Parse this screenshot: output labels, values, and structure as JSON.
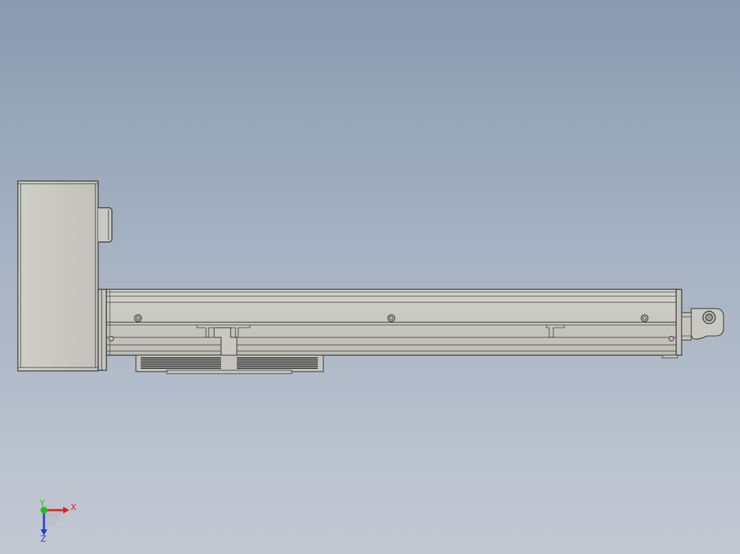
{
  "view": {
    "background_top": "#8a9bb0",
    "background_bottom": "#c3c9d3",
    "part_fill": "#c7c7c1",
    "part_edge": "#2a2a2a"
  },
  "triad": {
    "x_label": "X",
    "y_label": "Y",
    "z_label": "Z",
    "x_color": "#e02020",
    "y_color": "#20c020",
    "z_color": "#2040e0"
  }
}
